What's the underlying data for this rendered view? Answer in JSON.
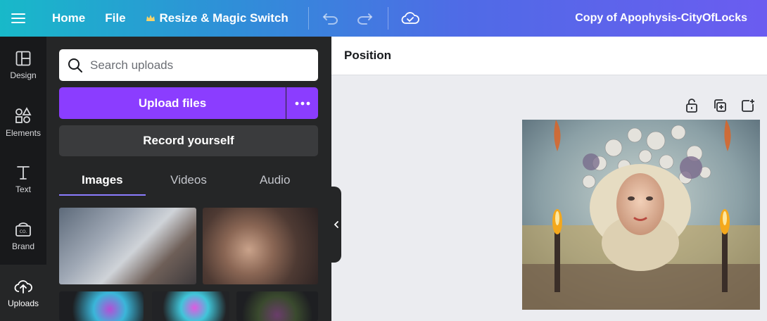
{
  "topbar": {
    "home": "Home",
    "file": "File",
    "resize": "Resize & Magic Switch",
    "title": "Copy of Apophysis-CityOfLocks"
  },
  "rail": {
    "items": [
      {
        "label": "Design",
        "icon": "layout-icon"
      },
      {
        "label": "Elements",
        "icon": "shapes-icon"
      },
      {
        "label": "Text",
        "icon": "text-icon"
      },
      {
        "label": "Brand",
        "icon": "brand-icon"
      },
      {
        "label": "Uploads",
        "icon": "cloud-upload-icon"
      }
    ]
  },
  "panel": {
    "search_placeholder": "Search uploads",
    "upload_label": "Upload files",
    "record_label": "Record yourself",
    "tabs": [
      "Images",
      "Videos",
      "Audio"
    ],
    "active_tab": "Images"
  },
  "editor": {
    "position_label": "Position"
  },
  "colors": {
    "accent": "#8b3dff",
    "rail_bg": "#18191b",
    "panel_bg": "#252627"
  }
}
